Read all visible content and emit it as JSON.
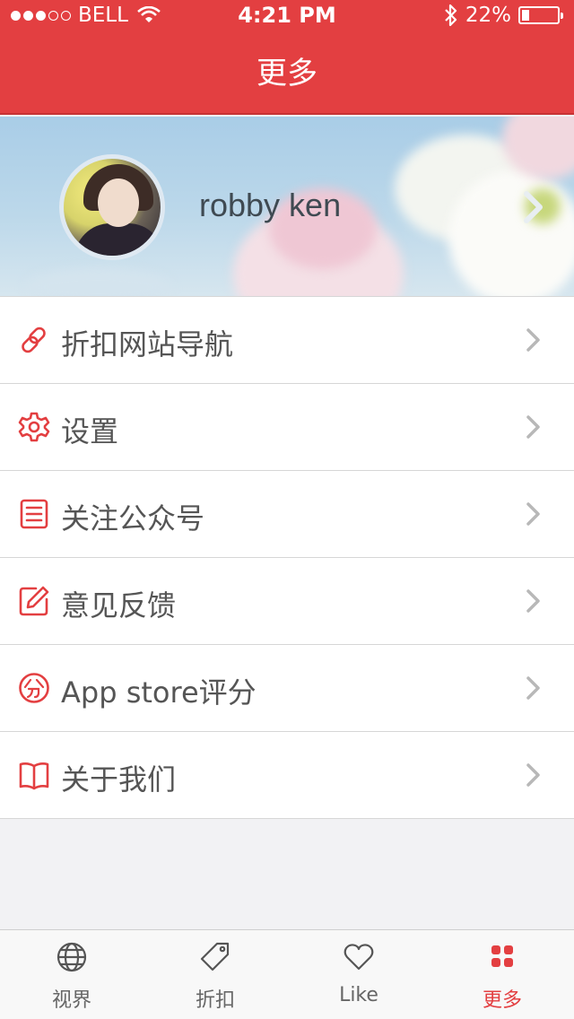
{
  "status_bar": {
    "carrier": "BELL",
    "time": "4:21 PM",
    "battery": "22%",
    "battery_level": 0.22,
    "signal_bars_on": 3,
    "signal_bars_total": 5
  },
  "nav": {
    "title": "更多"
  },
  "profile": {
    "username": "robby ken"
  },
  "menu": {
    "items": [
      {
        "label": "折扣网站导航",
        "icon": "link-icon"
      },
      {
        "label": "设置",
        "icon": "gear-icon"
      },
      {
        "label": "关注公众号",
        "icon": "document-icon"
      },
      {
        "label": "意见反馈",
        "icon": "edit-icon"
      },
      {
        "label": "App store评分",
        "icon": "score-icon"
      },
      {
        "label": "关于我们",
        "icon": "book-icon"
      }
    ]
  },
  "tabbar": {
    "tabs": [
      {
        "label": "视界",
        "icon": "globe-icon",
        "active": false
      },
      {
        "label": "折扣",
        "icon": "tag-icon",
        "active": false
      },
      {
        "label": "Like",
        "icon": "heart-icon",
        "active": false
      },
      {
        "label": "更多",
        "icon": "grid-icon",
        "active": true
      }
    ]
  },
  "colors": {
    "accent": "#e33f41",
    "text": "#555555",
    "divider": "#d6d6d6"
  }
}
